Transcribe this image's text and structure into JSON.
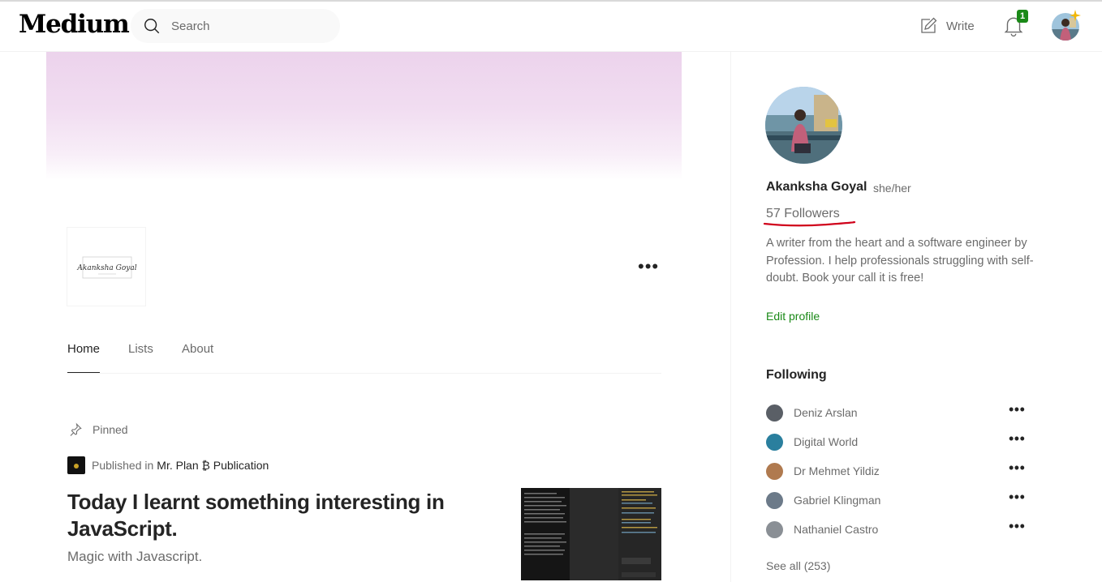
{
  "header": {
    "logo": "Medium",
    "search_placeholder": "Search",
    "write_label": "Write",
    "notification_count": "1"
  },
  "banner": {
    "color_top": "#ecd3ec"
  },
  "profile_brand": {
    "logo_text": "Akanksha Goyal"
  },
  "tabs": [
    {
      "label": "Home",
      "active": true
    },
    {
      "label": "Lists",
      "active": false
    },
    {
      "label": "About",
      "active": false
    }
  ],
  "pinned_post": {
    "pinned_label": "Pinned",
    "published_prefix": "Published in",
    "publication": "Mr. Plan ₿ Publication",
    "title": "Today I learnt something interesting in JavaScript.",
    "subtitle": "Magic with Javascript."
  },
  "sidebar": {
    "name": "Akanksha Goyal",
    "pronouns": "she/her",
    "followers": "57 Followers",
    "bio": "A writer from the heart and a software engineer by Profession. I help professionals struggling with self-doubt. Book your call it is free!",
    "edit_profile": "Edit profile",
    "following_heading": "Following",
    "following": [
      {
        "name": "Deniz Arslan",
        "color": "#5a5f66"
      },
      {
        "name": "Digital World",
        "color": "#2a7f9e"
      },
      {
        "name": "Dr Mehmet Yildiz",
        "color": "#b07a4f"
      },
      {
        "name": "Gabriel Klingman",
        "color": "#6c7a89"
      },
      {
        "name": "Nathaniel Castro",
        "color": "#8a8f95"
      }
    ],
    "see_all": "See all (253)"
  },
  "colors": {
    "accent_green": "#1a8917",
    "annotation_red": "#d0021b"
  }
}
